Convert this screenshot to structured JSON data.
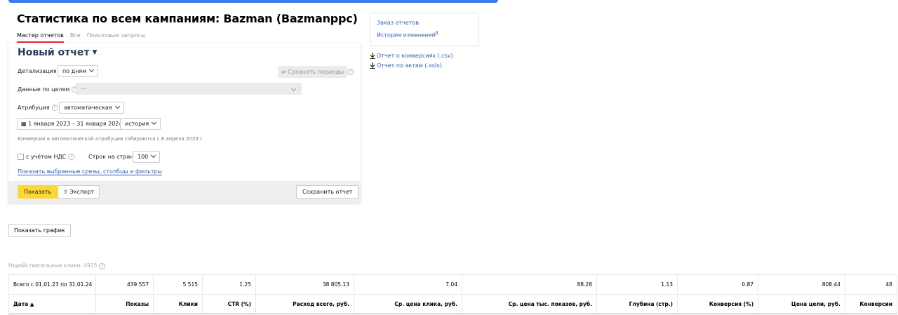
{
  "page": {
    "title": "Статистика по всем кампаниям: Bazman (Bazmanppc)",
    "tabs": [
      "Мастер отчетов",
      "Все",
      "Поисковые запросы"
    ]
  },
  "report": {
    "title": "Новый отчет",
    "detail_label": "Детализация",
    "detail_value": "по дням",
    "compare_button": "Сравнить периоды",
    "goals_label": "Данные по целям",
    "goals_value": "—",
    "attribution_label": "Атрибуция",
    "attribution_value": "автоматическая",
    "date_range": "1 января 2023 – 31 января 2024",
    "history_select": "история",
    "attribution_note": "Конверсии в автоматической атрибуции собираются с 8 апреля 2023 г.",
    "vat_label": "с учётом НДС",
    "rows_label": "Строк на странице",
    "rows_value": "100",
    "show_filters_link": "Показать выбранные срезы, столбцы и фильтры",
    "show_button": "Показать",
    "export_button": "Экспорт",
    "save_button": "Сохранить отчет"
  },
  "sidebar": {
    "order_reports": "Заказ отчетов",
    "change_history": "История изменений",
    "beta_mark": "β",
    "download_conversions": "Отчет о конверсиях (.csv)",
    "download_acts": "Отчет по актам (.xslx)"
  },
  "chart_button": "Показать график",
  "invalid_clicks": "Недействительные клики: 4915",
  "table": {
    "total_row": [
      "Всего с 01.01.23 по 31.01.24",
      "439 557",
      "5 515",
      "1.25",
      "38 805.13",
      "7.04",
      "88.28",
      "1.13",
      "0.87",
      "808.44",
      "48"
    ],
    "headers": [
      "Дата ▲",
      "Показы",
      "Клики",
      "CTR (%)",
      "Расход всего, руб.",
      "Ср. цена клика, руб.",
      "Ср. цена тыс. показов, руб.",
      "Глубина (стр.)",
      "Конверсия (%)",
      "Цена цели, руб.",
      "Конверсии"
    ]
  },
  "colors": {
    "accent_blue": "#3b7bf0",
    "link": "#2a5db0",
    "show_button": "#fdd835",
    "tab_underline": "#e23"
  }
}
